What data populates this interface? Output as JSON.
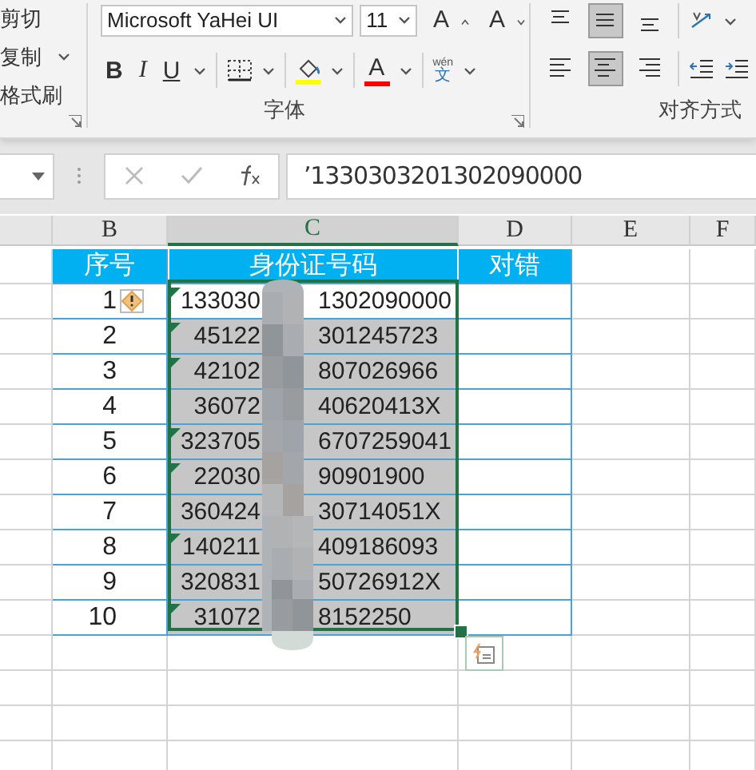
{
  "clipboard": {
    "items": [
      {
        "label": "剪切",
        "kind": "cut"
      },
      {
        "label": "复制",
        "kind": "copy"
      },
      {
        "label": "格式刷",
        "kind": "painter"
      }
    ]
  },
  "font": {
    "name": "Microsoft YaHei UI",
    "size": "11",
    "grow": "A",
    "shrink": "A",
    "label": "字体",
    "tools": [
      {
        "kind": "bold",
        "label": "B"
      },
      {
        "kind": "italic",
        "label": "I"
      },
      {
        "kind": "underline",
        "label": "U"
      },
      {
        "kind": "borders"
      },
      {
        "kind": "fill",
        "color": "#ffff00"
      },
      {
        "kind": "fontcolor",
        "label": "A",
        "color": "#ff0000"
      },
      {
        "kind": "phonetic",
        "ruby": "wén",
        "label": "文"
      }
    ]
  },
  "alignment": {
    "label": "对齐方式",
    "vertical": [
      {
        "kind": "top",
        "selected": false
      },
      {
        "kind": "middle",
        "selected": true
      },
      {
        "kind": "bottom",
        "selected": false
      }
    ],
    "horizontal": [
      {
        "kind": "left",
        "selected": false
      },
      {
        "kind": "center",
        "selected": true
      },
      {
        "kind": "right",
        "selected": false
      }
    ]
  },
  "formula_bar": {
    "value": "’1330303201302090000"
  },
  "columns": [
    {
      "label": "B",
      "selected": false
    },
    {
      "label": "C",
      "selected": true
    },
    {
      "label": "D",
      "selected": false
    },
    {
      "label": "E",
      "selected": false
    },
    {
      "label": "F",
      "selected": false
    }
  ],
  "table": {
    "headers": [
      "序号",
      "身份证号码",
      "对错"
    ],
    "rows": [
      {
        "number": "1",
        "id_start": "133030",
        "id_end": "1302090000",
        "error_flag": true,
        "active": true
      },
      {
        "number": "2",
        "id_start": "45122",
        "id_end": "301245723",
        "error_flag": true,
        "active": false
      },
      {
        "number": "3",
        "id_start": "42102",
        "id_end": "807026966",
        "error_flag": true,
        "active": false
      },
      {
        "number": "4",
        "id_start": "36072",
        "id_end": "40620413X",
        "error_flag": false,
        "active": false
      },
      {
        "number": "5",
        "id_start": "323705",
        "id_end": "6707259041",
        "error_flag": true,
        "active": false
      },
      {
        "number": "6",
        "id_start": "22030",
        "id_end": "90901900",
        "error_flag": true,
        "active": false
      },
      {
        "number": "7",
        "id_start": "360424",
        "id_end": "30714051X",
        "error_flag": false,
        "active": false
      },
      {
        "number": "8",
        "id_start": "140211",
        "id_end": "409186093",
        "error_flag": true,
        "active": false
      },
      {
        "number": "9",
        "id_start": "320831",
        "id_end": "50726912X",
        "error_flag": false,
        "active": false
      },
      {
        "number": "10",
        "id_start": "31072",
        "id_end": "8152250",
        "error_flag": true,
        "active": false
      }
    ]
  }
}
